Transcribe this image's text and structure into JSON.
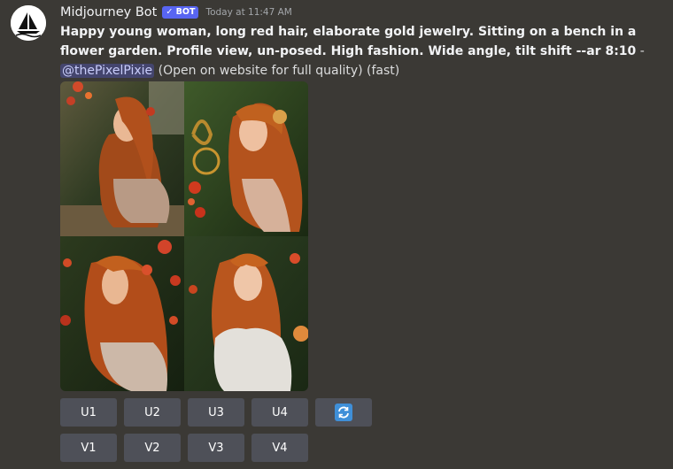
{
  "message": {
    "author": "Midjourney Bot",
    "badge": "✓ BOT",
    "timestamp": "Today at 11:47 AM",
    "prompt": "Happy young woman, long red hair, elaborate gold jewelry. Sitting on a bench in a flower garden. Profile view, un-posed. High fashion. Wide angle, tilt shift --ar 8:10",
    "separator": " - ",
    "mention": "@thePixelPixie",
    "suffix": " (Open on website for full quality) (fast)"
  },
  "image_grid": {
    "images": [
      {
        "subject": "woman-profile-left"
      },
      {
        "subject": "woman-profile-right"
      },
      {
        "subject": "woman-profile-left-flowers"
      },
      {
        "subject": "woman-front-white-blouse"
      }
    ]
  },
  "buttons": {
    "upscale": [
      "U1",
      "U2",
      "U3",
      "U4"
    ],
    "variation": [
      "V1",
      "V2",
      "V3",
      "V4"
    ],
    "reroll_icon": "reroll-icon"
  },
  "colors": {
    "background": "#3b3935",
    "button": "#4e5058",
    "bot_badge": "#5865f2",
    "mention_text": "#c9cdfb",
    "reroll": "#3f8fd8"
  }
}
